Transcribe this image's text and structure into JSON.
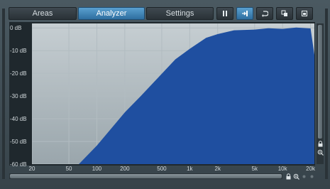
{
  "toolbar": {
    "tabs": [
      {
        "label": "Areas",
        "active": false
      },
      {
        "label": "Analyzer",
        "active": true
      },
      {
        "label": "Settings",
        "active": false
      }
    ],
    "buttons": [
      {
        "icon": "pause-icon",
        "active": false
      },
      {
        "icon": "input-arrow-icon",
        "active": true
      },
      {
        "icon": "reset-icon",
        "active": false
      },
      {
        "icon": "copy-icon",
        "active": false
      },
      {
        "icon": "paste-icon",
        "active": false
      }
    ]
  },
  "analyzer": {
    "db_labels": [
      "0 dB",
      "-10 dB",
      "-20 dB",
      "-30 dB",
      "-40 dB",
      "-50 dB",
      "-60 dB"
    ],
    "freq_labels": [
      "20",
      "50",
      "100",
      "200",
      "500",
      "1k",
      "2k",
      "5k",
      "10k",
      "20k"
    ],
    "fill_color": "#1f4fa0"
  },
  "chart_data": {
    "type": "area",
    "x": [
      60,
      100,
      200,
      300,
      500,
      700,
      1000,
      1500,
      2000,
      3000,
      5000,
      7000,
      10000,
      14000,
      20000,
      22000
    ],
    "y": [
      -61,
      -52,
      -37,
      -30,
      -20,
      -14,
      -9,
      -4.5,
      -2.5,
      -1.2,
      -0.5,
      -0.3,
      -0.2,
      0,
      0,
      -12
    ],
    "xlabel": "",
    "ylabel": "",
    "xlim": [
      20,
      22000
    ],
    "ylim": [
      -60,
      2
    ],
    "x_scale": "log",
    "x_ticks": [
      "20",
      "50",
      "100",
      "200",
      "500",
      "1k",
      "2k",
      "5k",
      "10k",
      "20k"
    ],
    "y_ticks": [
      "0 dB",
      "-10 dB",
      "-20 dB",
      "-30 dB",
      "-40 dB",
      "-50 dB",
      "-60 dB"
    ],
    "grid": true
  }
}
